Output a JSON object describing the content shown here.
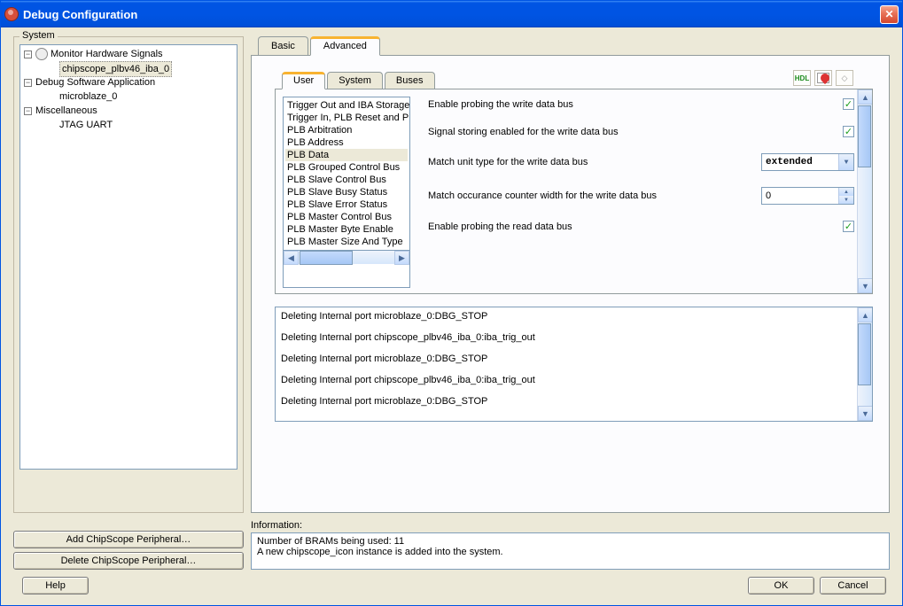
{
  "window": {
    "title": "Debug Configuration"
  },
  "tree": {
    "label": "System",
    "nodes": [
      {
        "label": "Monitor Hardware Signals",
        "children": [
          {
            "label": "chipscope_plbv46_iba_0",
            "selected": true
          }
        ]
      },
      {
        "label": "Debug Software Application",
        "children": [
          {
            "label": "microblaze_0"
          }
        ]
      },
      {
        "label": "Miscellaneous",
        "children": [
          {
            "label": "JTAG UART"
          }
        ]
      }
    ]
  },
  "buttons": {
    "add": "Add ChipScope Peripheral…",
    "delete": "Delete ChipScope Peripheral…",
    "help": "Help",
    "ok": "OK",
    "cancel": "Cancel"
  },
  "outerTabs": {
    "tabs": [
      "Basic",
      "Advanced"
    ],
    "active": 1
  },
  "innerTabs": {
    "tabs": [
      "User",
      "System",
      "Buses"
    ],
    "active": 0
  },
  "listItems": [
    "Trigger Out and IBA Storage",
    "Trigger In, PLB Reset and PLB",
    "PLB Arbitration",
    "PLB Address",
    "PLB Data",
    "PLB Grouped Control Bus",
    "PLB Slave Control Bus",
    "PLB Slave Busy Status",
    "PLB Slave Error Status",
    "PLB Master Control Bus",
    "PLB Master Byte Enable",
    "PLB Master Size And Type"
  ],
  "listSelectedIndex": 4,
  "form": {
    "row1": {
      "label": "Enable probing the write data bus",
      "checked": true
    },
    "row2": {
      "label": "Signal storing enabled for the write data bus",
      "checked": true
    },
    "row3": {
      "label": "Match unit type for the write data bus",
      "value": "extended"
    },
    "row4": {
      "label": "Match occurance counter width for the write data bus",
      "value": "0"
    },
    "row5": {
      "label": "Enable probing the read data bus",
      "checked": true
    }
  },
  "log": [
    "Deleting Internal port microblaze_0:DBG_STOP",
    "Deleting Internal port chipscope_plbv46_iba_0:iba_trig_out",
    "Deleting Internal port microblaze_0:DBG_STOP",
    "Deleting Internal port chipscope_plbv46_iba_0:iba_trig_out",
    "Deleting Internal port microblaze_0:DBG_STOP"
  ],
  "info": {
    "label": "Information:",
    "line1": "Number of BRAMs being used: 11",
    "line2": "A new chipscope_icon instance is added into the system."
  }
}
